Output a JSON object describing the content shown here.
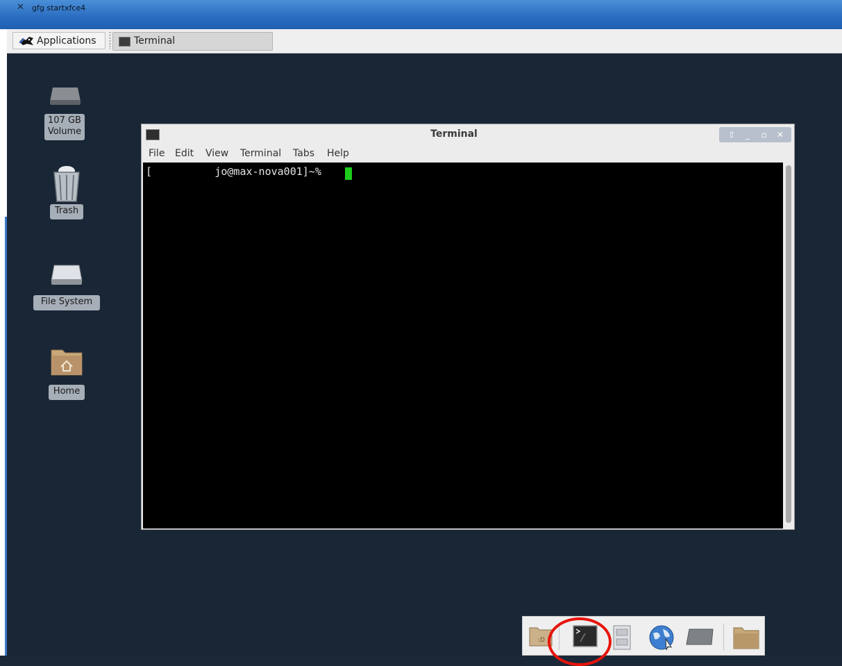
{
  "x_window": {
    "title": "gfg startxfce4"
  },
  "panel": {
    "applications_label": "Applications",
    "tasks": [
      {
        "label": "Terminal"
      }
    ]
  },
  "desktop": {
    "icons": [
      {
        "label": "107 GB Volume",
        "icon": "drive-icon"
      },
      {
        "label": "Trash",
        "icon": "trash-icon"
      },
      {
        "label": "File System",
        "icon": "filesystem-icon"
      },
      {
        "label": "Home",
        "icon": "home-folder-icon"
      }
    ]
  },
  "terminal": {
    "title": "Terminal",
    "menu": [
      "File",
      "Edit",
      "View",
      "Terminal",
      "Tabs",
      "Help"
    ],
    "prompt": "[          jo@max-nova001]~%"
  },
  "dock": {
    "items": [
      "home-folder-icon",
      "terminal-icon",
      "file-cabinet-icon",
      "web-browser-icon",
      "drive-icon",
      "folder-icon"
    ]
  },
  "colors": {
    "desktop": "#192636",
    "cursor": "#1dcc1d",
    "highlight": "#e8140c",
    "x_titlebar": "#2c6fc2"
  }
}
